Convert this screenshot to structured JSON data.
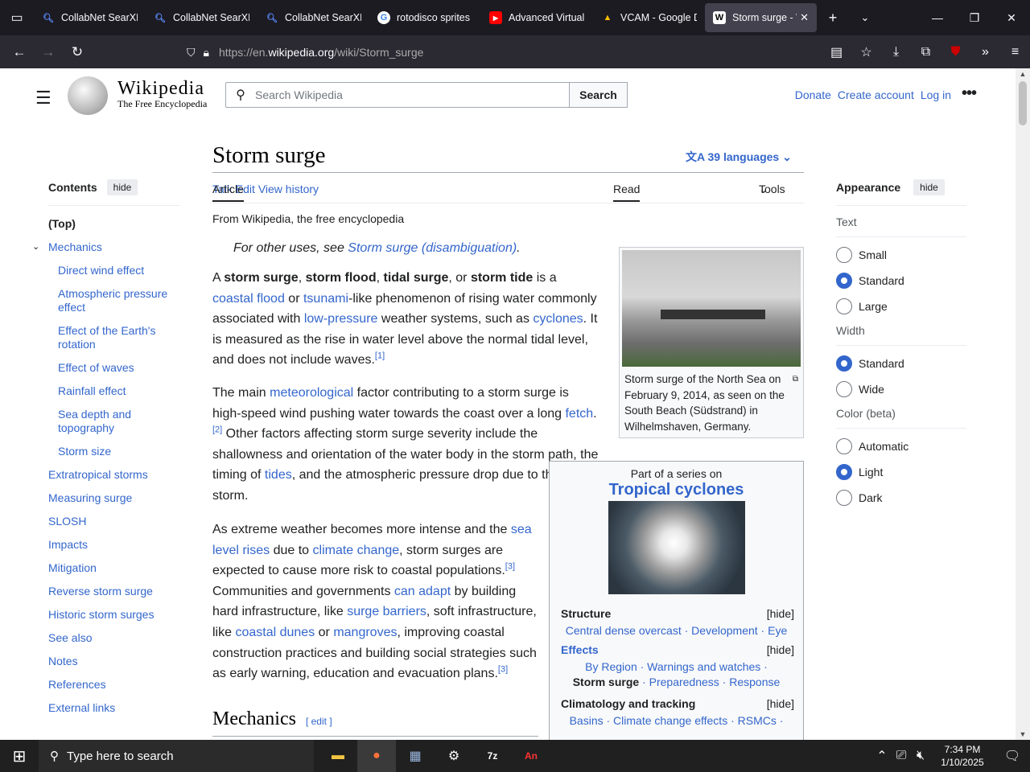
{
  "browser": {
    "tabs": [
      {
        "title": "CollabNet SearXNG",
        "icon": "search-icon"
      },
      {
        "title": "CollabNet SearXNG",
        "icon": "search-icon"
      },
      {
        "title": "CollabNet SearXNG",
        "icon": "search-icon"
      },
      {
        "title": "rotodisco sprites s",
        "icon": "google-icon"
      },
      {
        "title": "Advanced Virtual C",
        "icon": "youtube-icon"
      },
      {
        "title": "VCAM - Google Dr",
        "icon": "drive-icon"
      },
      {
        "title": "Storm surge - W",
        "icon": "wikipedia-icon"
      }
    ],
    "url_prefix": "https://en.",
    "url_host": "wikipedia.org",
    "url_path": "/wiki/Storm_surge"
  },
  "wiki": {
    "logo_word": "Wikipedia",
    "logo_tagline": "The Free Encyclopedia",
    "search_placeholder": "Search Wikipedia",
    "search_button": "Search",
    "donate": "Donate",
    "create_account": "Create account",
    "login": "Log in",
    "contents_title": "Contents",
    "hide": "hide",
    "toc": [
      "(Top)",
      "Mechanics",
      "Direct wind effect",
      "Atmospheric pressure effect",
      "Effect of the Earth's rotation",
      "Effect of waves",
      "Rainfall effect",
      "Sea depth and topography",
      "Storm size",
      "Extratropical storms",
      "Measuring surge",
      "SLOSH",
      "Impacts",
      "Mitigation",
      "Reverse storm surge",
      "Historic storm surges",
      "See also",
      "Notes",
      "References",
      "External links"
    ],
    "title": "Storm surge",
    "languages": "39 languages",
    "tab_article": "Article",
    "tab_talk": "Talk",
    "tab_read": "Read",
    "tab_edit": "Edit",
    "tab_history": "View history",
    "tab_tools": "Tools",
    "from": "From Wikipedia, the free encyclopedia",
    "hatnote_pre": "For other uses, see ",
    "hatnote_link": "Storm surge (disambiguation)",
    "hatnote_post": ".",
    "caption": "Storm surge of the North Sea on February 9, 2014, as seen on the South Beach (Südstrand) in Wilhelmshaven, Germany.",
    "infobox_part": "Part of a series on",
    "infobox_title": "Tropical cyclones",
    "infobox_hide": "[hide]",
    "infobox_structure": "Structure",
    "infobox_structure_links": "Central dense overcast · Development · Eye",
    "infobox_effects": "Effects",
    "infobox_effects_links1": "By Region · Warnings and watches ·",
    "infobox_effects_bold": "Storm surge",
    "infobox_effects_links2": " · Preparedness · Response",
    "infobox_clim": "Climatology and tracking",
    "infobox_clim_links": "Basins · Climate change effects · RSMCs ·",
    "h2": "Mechanics",
    "h2_edit": "[ edit ]",
    "appearance": "Appearance",
    "text_label": "Text",
    "text_opts": [
      "Small",
      "Standard",
      "Large"
    ],
    "width_label": "Width",
    "width_opts": [
      "Standard",
      "Wide"
    ],
    "color_label": "Color (beta)",
    "color_opts": [
      "Automatic",
      "Light",
      "Dark"
    ]
  },
  "taskbar": {
    "search": "Type here to search",
    "time": "7:34 PM",
    "date": "1/10/2025"
  }
}
